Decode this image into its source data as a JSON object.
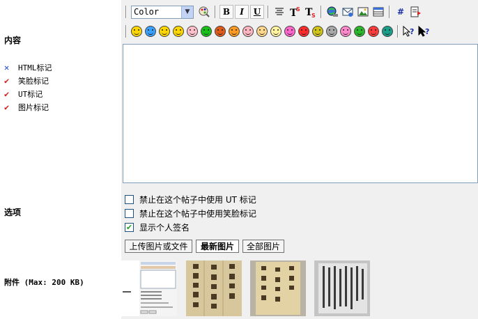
{
  "labels": {
    "content": "内容",
    "options": "选项",
    "attachments": "附件 (Max: 200 KB)"
  },
  "permissions": [
    {
      "label": "HTML标记",
      "state": "off"
    },
    {
      "label": "笑脸标记",
      "state": "on"
    },
    {
      "label": "UT标记",
      "state": "on"
    },
    {
      "label": "图片标记",
      "state": "on"
    }
  ],
  "toolbar": {
    "color_select_value": "Color",
    "bold": "B",
    "italic": "I",
    "underline": "U",
    "hash": "#"
  },
  "smilies": [
    {
      "name": "smile",
      "color": "#ffd700"
    },
    {
      "name": "sad",
      "color": "#3aa0ff"
    },
    {
      "name": "grin",
      "color": "#ffd700"
    },
    {
      "name": "cool",
      "color": "#ffd700"
    },
    {
      "name": "surprised",
      "color": "#ffc0cb"
    },
    {
      "name": "green-face",
      "color": "#19c219"
    },
    {
      "name": "devil",
      "color": "#e05a1a"
    },
    {
      "name": "wink",
      "color": "#ff9a20"
    },
    {
      "name": "clown",
      "color": "#ffb6c1"
    },
    {
      "name": "dizzy",
      "color": "#ffd68a"
    },
    {
      "name": "eyes",
      "color": "#fff3a0"
    },
    {
      "name": "shocked",
      "color": "#ff66cc"
    },
    {
      "name": "angry",
      "color": "#ff2a2a"
    },
    {
      "name": "sick",
      "color": "#d1c41a"
    },
    {
      "name": "neutral",
      "color": "#a8a8a8"
    },
    {
      "name": "love",
      "color": "#ff88cc"
    },
    {
      "name": "minus",
      "color": "#2bb82b"
    },
    {
      "name": "mad",
      "color": "#ff3a3a"
    },
    {
      "name": "question",
      "color": "#1aa08a"
    }
  ],
  "options": [
    {
      "label": "禁止在这个帖子中使用 UT 标记",
      "checked": false
    },
    {
      "label": "禁止在这个帖子中使用笑脸标记",
      "checked": false
    },
    {
      "label": "显示个人签名",
      "checked": true
    }
  ],
  "attachment_tabs": [
    {
      "label": "上传图片或文件",
      "active": false
    },
    {
      "label": "最新图片",
      "active": true
    },
    {
      "label": "全部图片",
      "active": false
    }
  ],
  "colors": {
    "panel_bg": "#f0f0f0",
    "border": "#7f9db9",
    "cross": "#1a3ec8",
    "check": "#d21a1a"
  }
}
